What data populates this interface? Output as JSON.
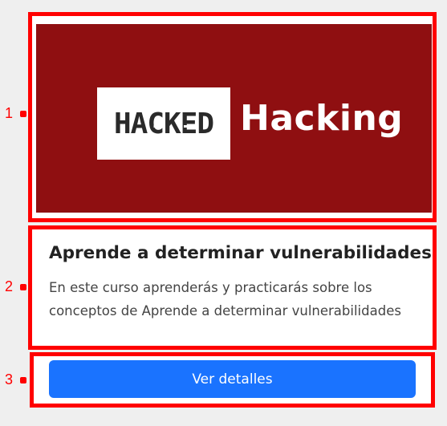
{
  "annotations": [
    "1",
    "2",
    "3"
  ],
  "banner": {
    "logo_text": "HACKED",
    "brand_text": "Hacking",
    "background_color": "#8f0f11"
  },
  "card": {
    "title": "Aprende a determinar vulnerabilidades",
    "description": "En este curso aprenderás y practicarás sobre los conceptos de Aprende a determinar vulnerabilidades",
    "button_label": "Ver detalles",
    "button_color": "#1a73ff"
  },
  "highlight_color": "#ff0000"
}
